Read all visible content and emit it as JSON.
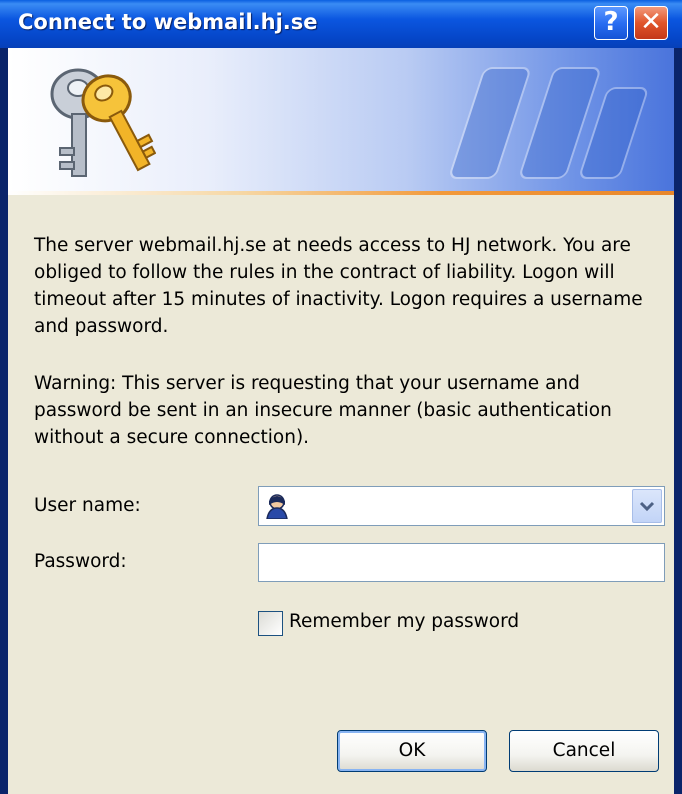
{
  "window": {
    "title": "Connect to webmail.hj.se",
    "help_glyph": "?",
    "close_glyph": "✕"
  },
  "banner": {
    "icon": "keys-icon",
    "watermark": "keys-watermark"
  },
  "message": {
    "paragraph1": "The server webmail.hj.se at needs access to HJ network. You are obliged to follow the rules in the contract of liability. Logon will timeout after 15 minutes of inactivity. Logon  requires a username and password.",
    "paragraph2": "Warning: This server is requesting that your username and password be sent in an insecure manner (basic authentication without a secure connection)."
  },
  "form": {
    "username_label": "User name:",
    "username_value": "",
    "password_label": "Password:",
    "password_value": "",
    "remember_label": "Remember my password",
    "remember_checked": false
  },
  "buttons": {
    "ok_label": "OK",
    "cancel_label": "Cancel"
  },
  "colors": {
    "titlebar": "#0b56e0",
    "dialog_bg": "#ece9d8",
    "close_button": "#e0542a",
    "accent_line": "#f29a3b"
  }
}
